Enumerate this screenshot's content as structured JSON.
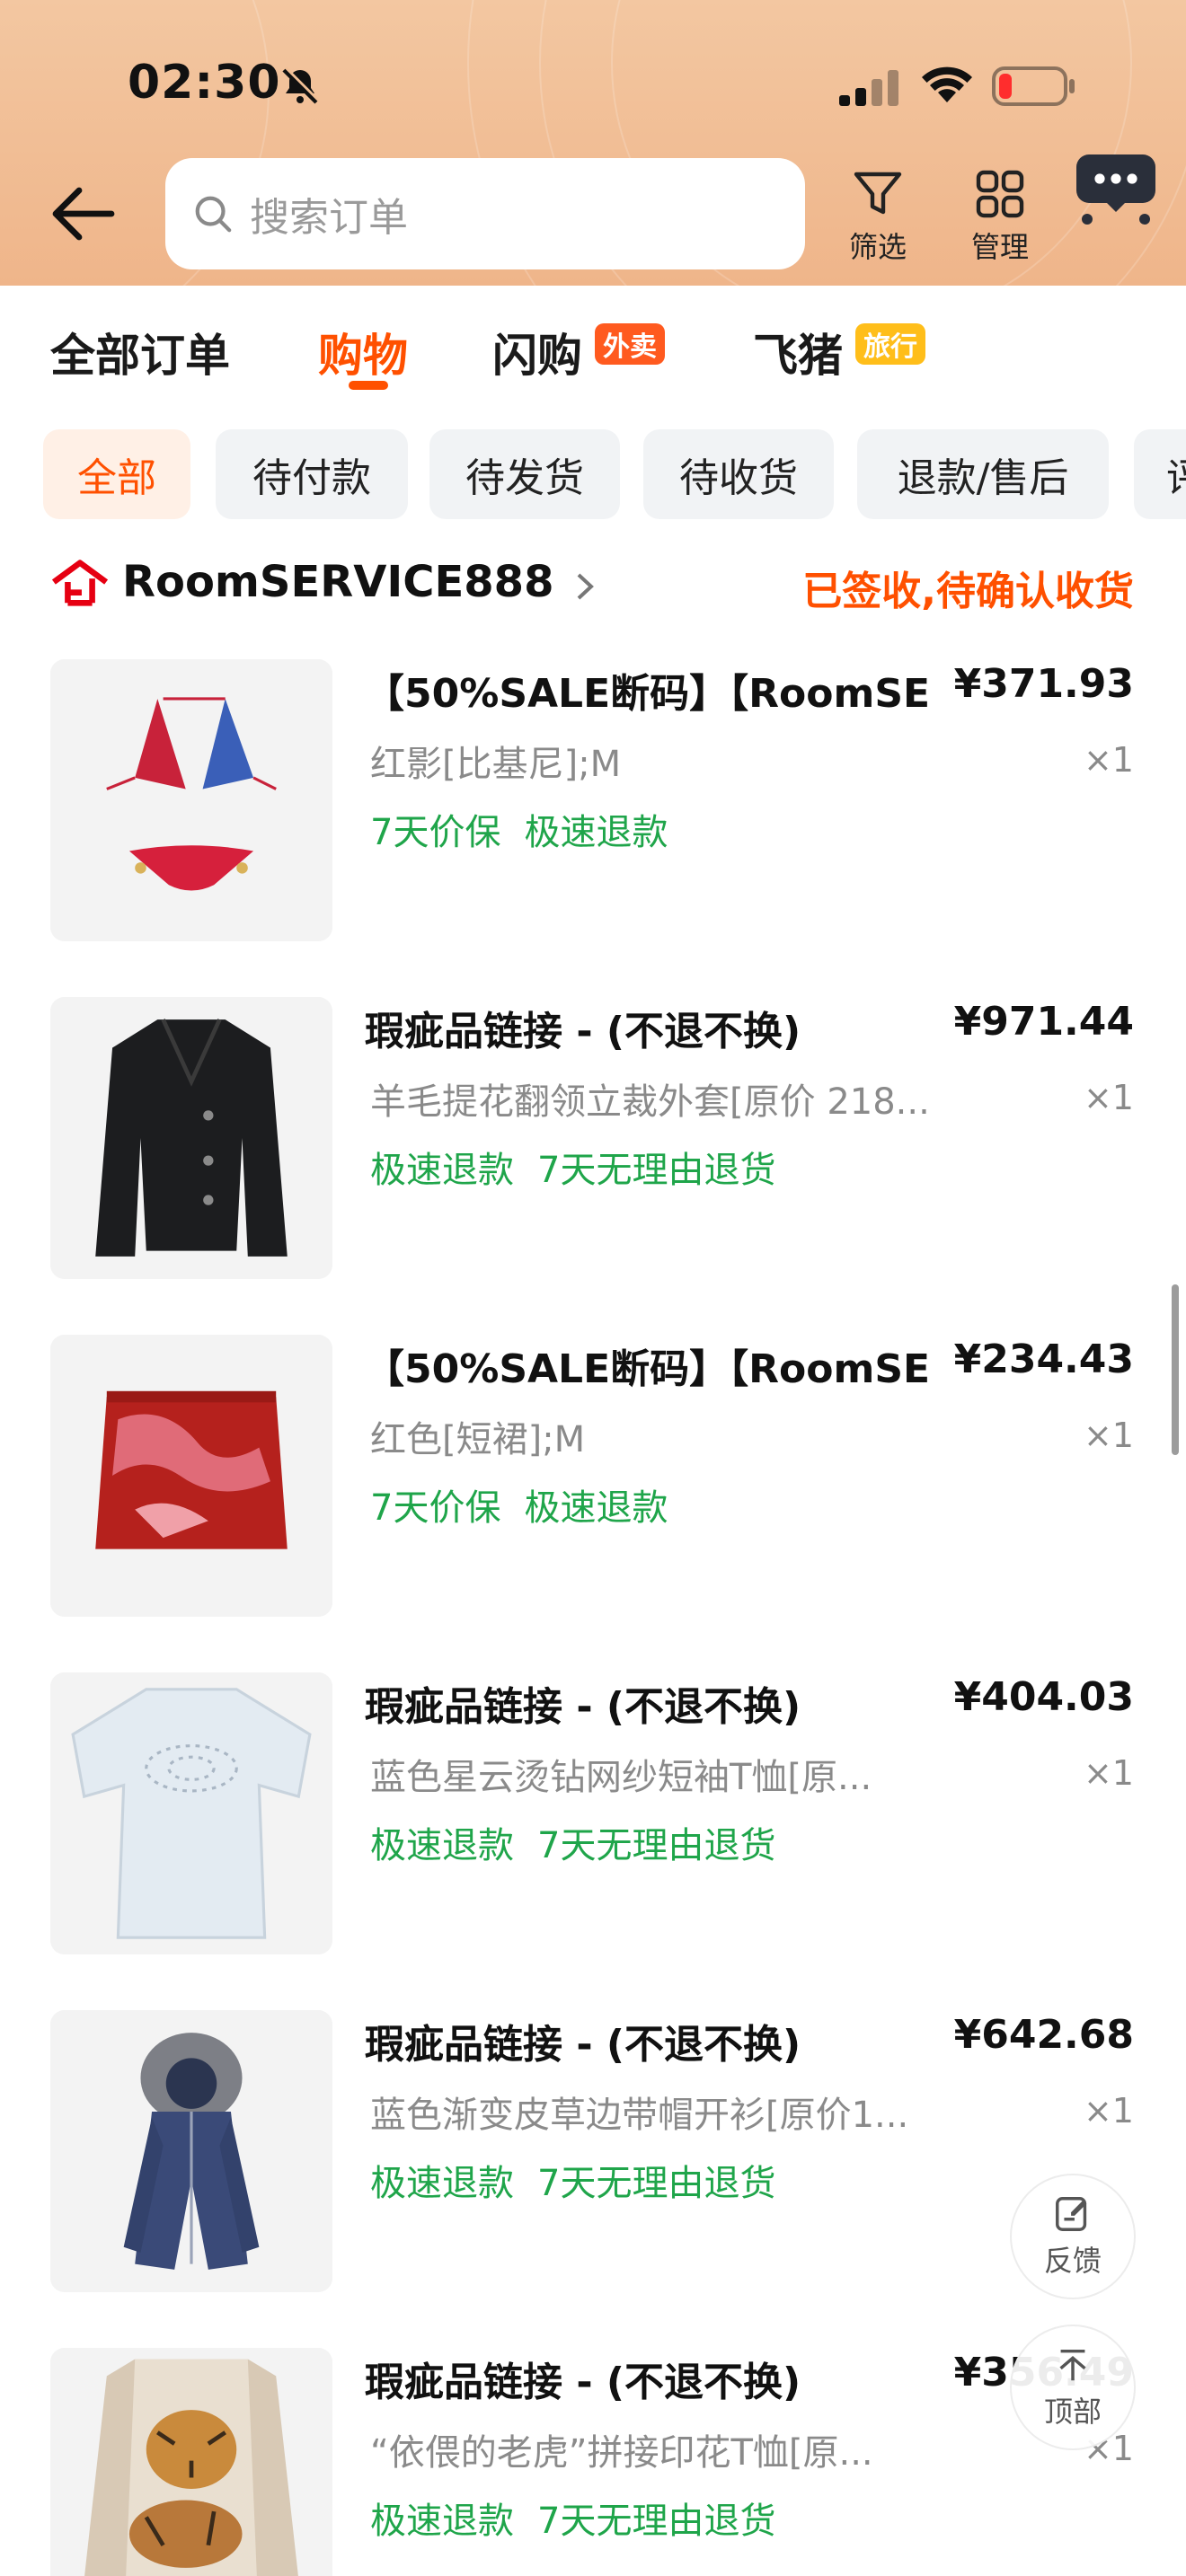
{
  "status_bar": {
    "time": "02:30"
  },
  "header": {
    "search_placeholder": "搜索订单",
    "filter_label": "筛选",
    "manage_label": "管理"
  },
  "main_tabs": [
    {
      "label": "全部订单"
    },
    {
      "label": "购物",
      "active": true
    },
    {
      "label": "闪购",
      "badge": "外卖",
      "badge_color": "#ff5a1f"
    },
    {
      "label": "飞猪",
      "badge": "旅行",
      "badge_color": "#ffbe1a"
    }
  ],
  "filter_chips": [
    {
      "label": "全部",
      "active": true
    },
    {
      "label": "待付款"
    },
    {
      "label": "待发货"
    },
    {
      "label": "待收货"
    },
    {
      "label": "退款/售后"
    },
    {
      "label": "评"
    }
  ],
  "store": {
    "name": "RoomSERVICE888",
    "status": "已签收,待确认收货"
  },
  "items": [
    {
      "title": "【50%SALE断码】【RoomSE",
      "price": "¥371.93",
      "spec": "红影[比基尼];M",
      "qty": "×1",
      "tags": [
        "7天价保",
        "极速退款"
      ]
    },
    {
      "title": "瑕疵品链接 - (不退不换)",
      "price": "¥971.44",
      "spec": "羊毛提花翻领立裁外套[原价 218...",
      "qty": "×1",
      "tags": [
        "极速退款",
        "7天无理由退货"
      ]
    },
    {
      "title": "【50%SALE断码】【RoomSE",
      "price": "¥234.43",
      "spec": "红色[短裙];M",
      "qty": "×1",
      "tags": [
        "7天价保",
        "极速退款"
      ]
    },
    {
      "title": "瑕疵品链接 - (不退不换)",
      "price": "¥404.03",
      "spec": "蓝色星云烫钻网纱短袖T恤[原...",
      "qty": "×1",
      "tags": [
        "极速退款",
        "7天无理由退货"
      ]
    },
    {
      "title": "瑕疵品链接 - (不退不换)",
      "price": "¥642.68",
      "spec": "蓝色渐变皮草边带帽开衫[原价1...",
      "qty": "×1",
      "tags": [
        "极速退款",
        "7天无理由退货"
      ]
    },
    {
      "title": "瑕疵品链接 - (不退不换)",
      "price": "¥356.49",
      "spec": "“依偎的老虎”拼接印花T恤[原...",
      "qty": "×1",
      "tags": [
        "极速退款",
        "7天无理由退货"
      ]
    }
  ],
  "float_buttons": {
    "feedback": "反馈",
    "top": "顶部"
  },
  "colors": {
    "accent": "#ff5000",
    "tag_green": "#1fa54a",
    "header_bg": "#f3c7a1"
  }
}
